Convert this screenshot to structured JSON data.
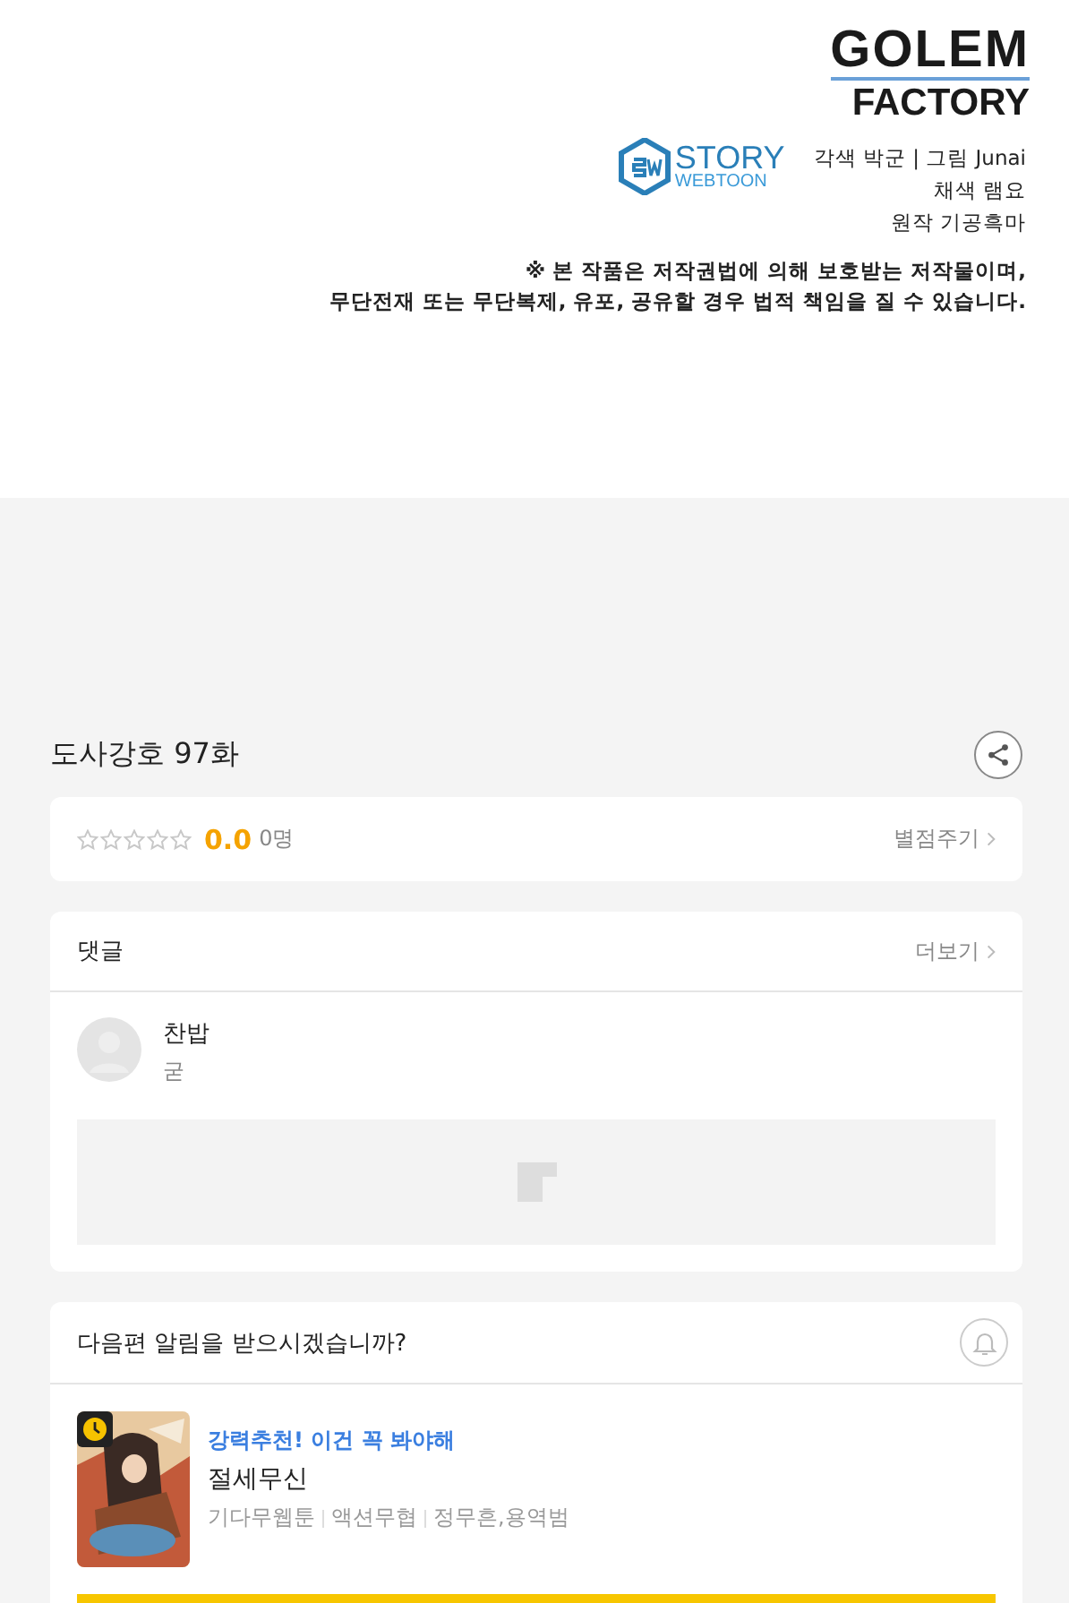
{
  "credits": {
    "logo_top": "GOLEM",
    "logo_bottom": "FACTORY",
    "studio_top": "STORY",
    "studio_bottom": "WEBTOON",
    "lines": [
      "각색 박군 | 그림 Junai",
      "채색 램요",
      "원작 기공흑마"
    ],
    "notice": [
      "※ 본 작품은 저작권법에 의해 보호받는 저작물이며,",
      "무단전재 또는 무단복제, 유포, 공유할 경우 법적 책임을 질 수 있습니다."
    ]
  },
  "episode": {
    "title": "도사강호 97화"
  },
  "rating": {
    "stars": 0,
    "score": "0.0",
    "count": "0명",
    "action": "별점주기"
  },
  "comments": {
    "title": "댓글",
    "more": "더보기",
    "items": [
      {
        "author": "찬밥",
        "text": "굳"
      }
    ]
  },
  "notify": {
    "question": "다음편 알림을 받으시겠습니까?"
  },
  "recommend": {
    "tagline": "강력추천! 이건 꼭 봐야해",
    "title": "절세무신",
    "meta": [
      "기다무웹툰",
      "액션무협",
      "정무흔,용역범"
    ]
  }
}
